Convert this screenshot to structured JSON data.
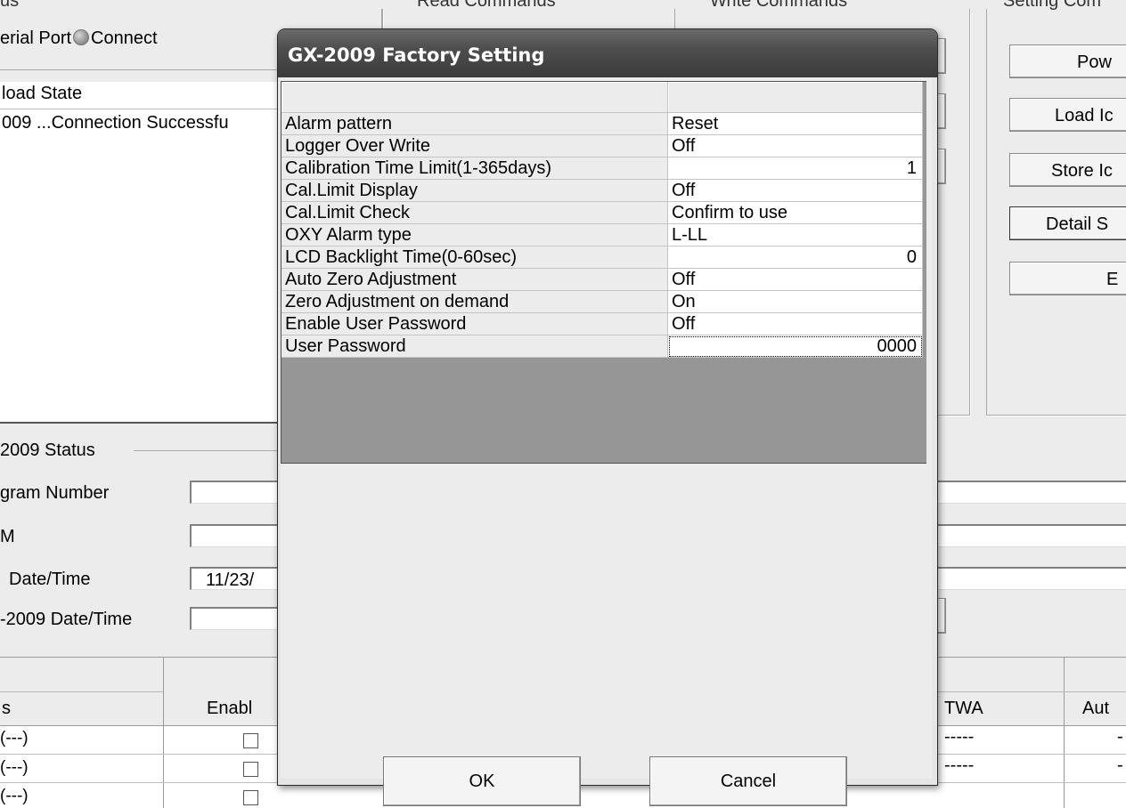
{
  "background": {
    "top_left_partial": "us",
    "serial_port_label": "erial Port",
    "connect_label": "Connect",
    "read_commands_group": "Read Commands",
    "write_commands_group": "Write Commands",
    "setting_commands_group": "Setting Com",
    "right_buttons": [
      "Pow",
      "Load Ic",
      "Store Ic",
      "Detail S",
      "E"
    ],
    "load_state_label": "load State",
    "load_state_text": "009 ...Connection Successfu",
    "status_group_label": "2009 Status",
    "status_fields": [
      {
        "label": "gram Number",
        "value": ""
      },
      {
        "label": "M",
        "value": ""
      },
      {
        "label": "Date/Time",
        "value": "11/23/"
      },
      {
        "label": "-2009 Date/Time",
        "value": ""
      }
    ],
    "table": {
      "col_s": "s",
      "col_enable": "Enabl",
      "col_twa": "TWA",
      "col_aut": "Aut",
      "rows": [
        {
          "name": "(---)",
          "twa": "-----",
          "aut": "-"
        },
        {
          "name": "(---)",
          "twa": "-----",
          "aut": "-"
        },
        {
          "name": "(---)",
          "twa": "-----",
          "aut": "-"
        }
      ]
    }
  },
  "dialog": {
    "title": "GX-2009 Factory Setting",
    "properties": [
      {
        "label": "Alarm pattern",
        "value": "Reset",
        "numeric": false
      },
      {
        "label": "Logger Over Write",
        "value": "Off",
        "numeric": false
      },
      {
        "label": "Calibration Time Limit(1-365days)",
        "value": "1",
        "numeric": true
      },
      {
        "label": "Cal.Limit Display",
        "value": "Off",
        "numeric": false
      },
      {
        "label": "Cal.Limit Check",
        "value": "Confirm to use",
        "numeric": false
      },
      {
        "label": "OXY Alarm type",
        "value": "L-LL",
        "numeric": false
      },
      {
        "label": "LCD Backlight Time(0-60sec)",
        "value": "0",
        "numeric": true
      },
      {
        "label": "Auto Zero Adjustment",
        "value": "Off",
        "numeric": false
      },
      {
        "label": "Zero Adjustment on demand",
        "value": "On",
        "numeric": false
      },
      {
        "label": "Enable User Password",
        "value": "Off",
        "numeric": false
      },
      {
        "label": "User Password",
        "value": "0000",
        "numeric": true
      }
    ],
    "ok_label": "OK",
    "cancel_label": "Cancel"
  }
}
